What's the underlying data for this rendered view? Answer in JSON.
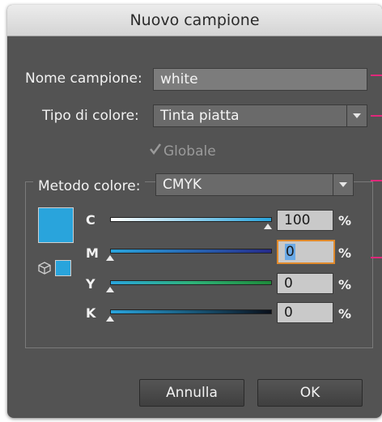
{
  "dialog": {
    "title": "Nuovo campione",
    "swatch_name_label": "Nome campione:",
    "swatch_name_value": "white",
    "color_type_label": "Tipo di colore:",
    "color_type_value": "Tinta piatta",
    "global_label": "Globale",
    "global_checked": true,
    "color_mode_label": "Metodo colore:",
    "color_mode_value": "CMYK",
    "swatch_color": "#29a4dc",
    "sliders": [
      {
        "label": "C",
        "value": "100",
        "unit": "%",
        "fraction": 1.0
      },
      {
        "label": "M",
        "value": "0",
        "unit": "%",
        "fraction": 0.0
      },
      {
        "label": "Y",
        "value": "0",
        "unit": "%",
        "fraction": 0.0
      },
      {
        "label": "K",
        "value": "0",
        "unit": "%",
        "fraction": 0.0
      }
    ],
    "cancel_label": "Annulla",
    "ok_label": "OK"
  },
  "colors": {
    "dialog_bg": "#535353",
    "accent_pink": "#e0287a",
    "focus_orange": "#e08a2c",
    "swatch_blue": "#29a4dc"
  }
}
